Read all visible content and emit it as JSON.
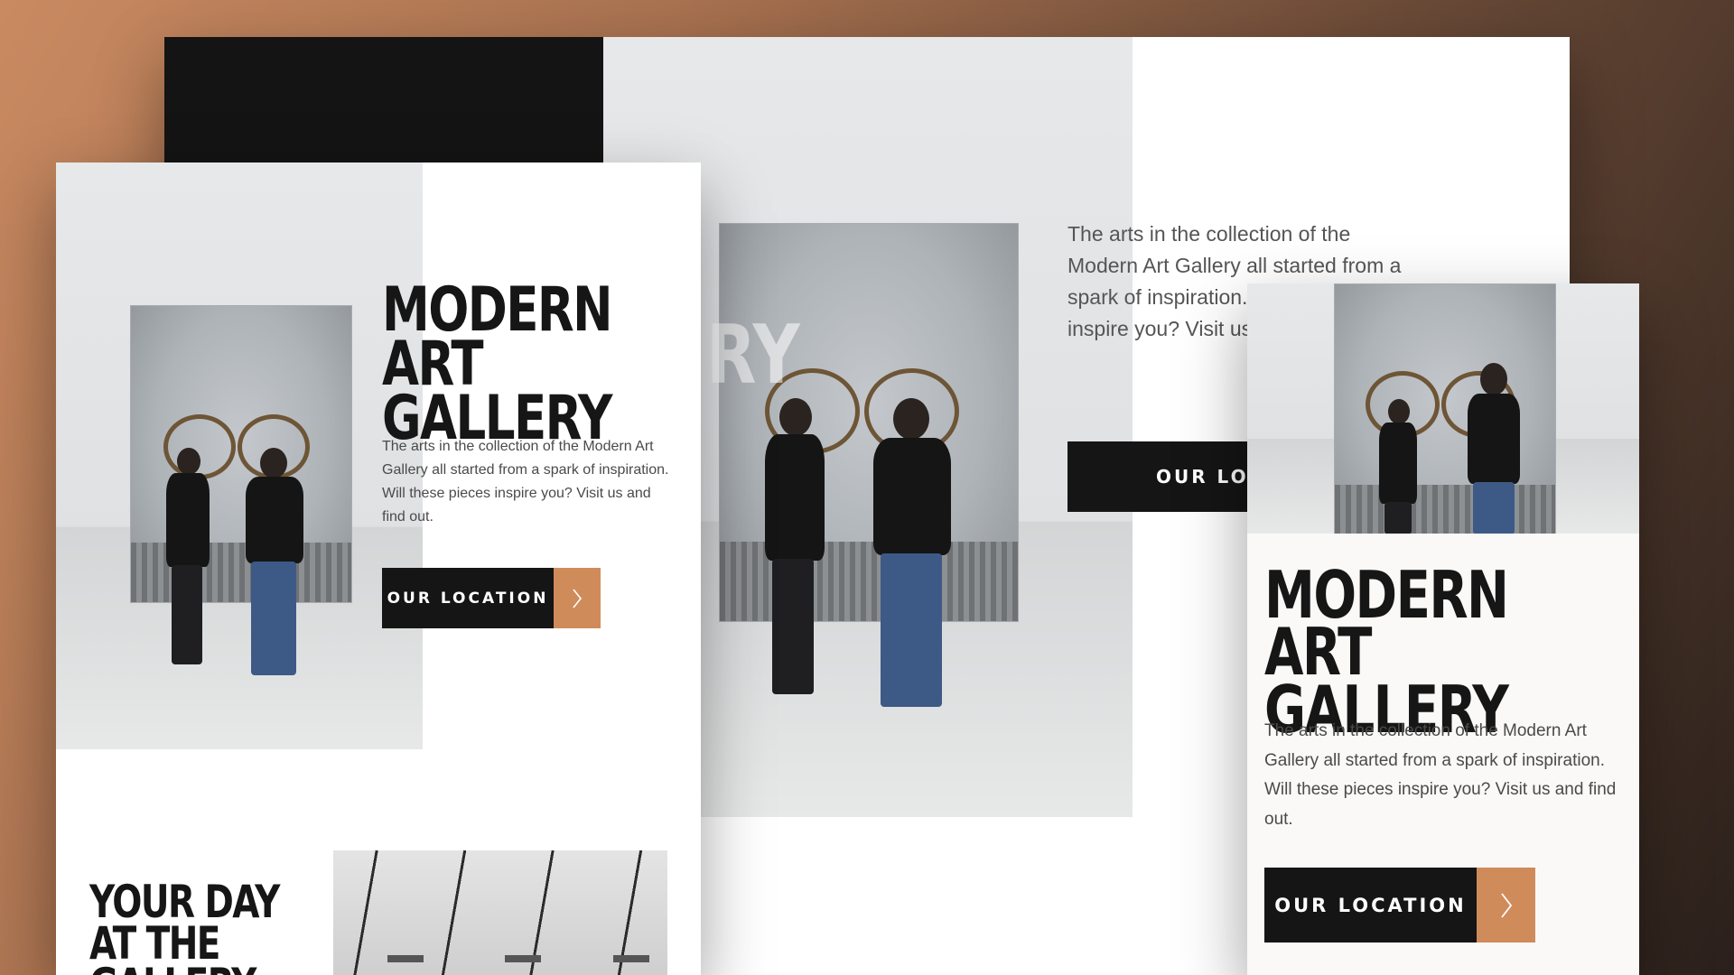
{
  "desktop": {
    "ghost_letters": "RY",
    "paragraph": "The arts in the collection of the Modern Art Gallery all started from a spark of inspiration. Will these pieces inspire you? Visit us and find out.",
    "cta_label": "OUR LOCATION"
  },
  "tablet": {
    "heading_line1": "MODERN",
    "heading_line2": "ART GALLERY",
    "paragraph": "The arts in the collection of the Modern Art Gallery all started from a spark of inspiration. Will these pieces inspire you? Visit us and find out.",
    "cta_label": "OUR LOCATION",
    "section_heading_line1": "YOUR DAY",
    "section_heading_line2": "AT THE",
    "section_heading_line3": "GALLERY"
  },
  "mobile": {
    "heading_line1": "MODERN",
    "heading_line2": "ART GALLERY",
    "paragraph": "The arts in the collection of the Modern Art Gallery all started from a spark of inspiration. Will these pieces inspire you? Visit us and find out.",
    "cta_label": "OUR LOCATION"
  },
  "icons": {
    "cta_arrow": "chevron-right-icon"
  },
  "colors": {
    "accent": "#d08b5b",
    "dark": "#151515",
    "heading": "#161616",
    "page_bg": "#ffffff",
    "mobile_bg": "#faf9f7"
  }
}
